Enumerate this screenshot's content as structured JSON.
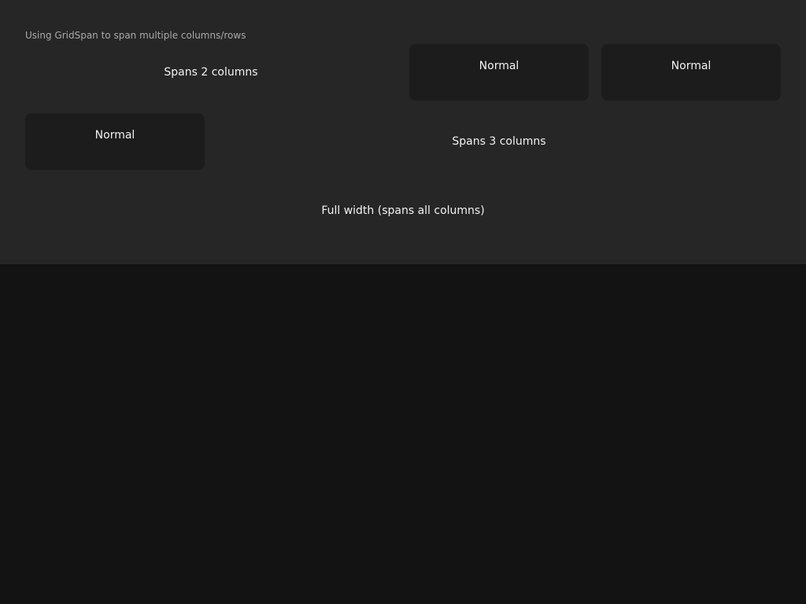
{
  "window": {
    "caption": "Using GridSpan to span multiple columns/rows"
  },
  "grid": {
    "row1": {
      "span2_label": "Spans 2 columns",
      "normal_a_label": "Normal",
      "normal_b_label": "Normal"
    },
    "row2": {
      "normal_label": "Normal",
      "span3_label": "Spans 3 columns"
    },
    "row3": {
      "full_label": "Full width (spans all columns)"
    }
  },
  "colors": {
    "panel_background": "#262626",
    "page_background": "#131313",
    "card_background": "#1c1c1c",
    "text_primary": "#f2f2f2",
    "text_secondary": "#a9a9a9"
  }
}
